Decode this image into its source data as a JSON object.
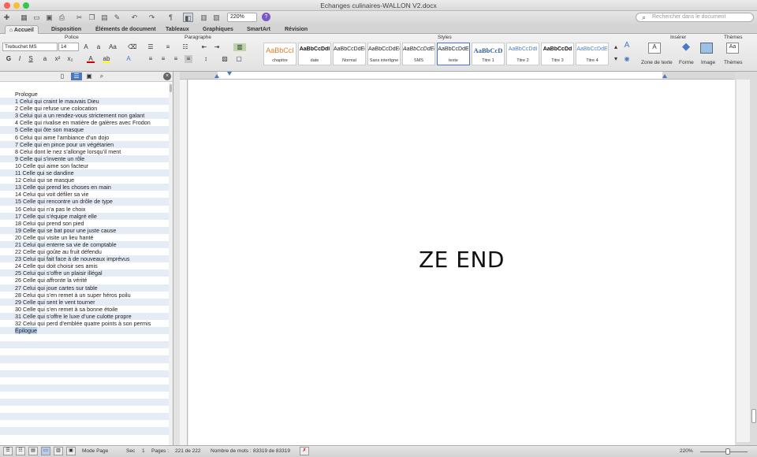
{
  "window": {
    "title": "Echanges culinaires-WALLON V2.docx"
  },
  "toolbar": {
    "zoom": "220%",
    "search_placeholder": "Rechercher dans le document"
  },
  "tabs": [
    "Accueil",
    "Disposition",
    "Éléments de document",
    "Tableaux",
    "Graphiques",
    "SmartArt",
    "Révision"
  ],
  "ribbon": {
    "groups": {
      "police": "Police",
      "paragraphe": "Paragraphe",
      "styles": "Styles",
      "inserer": "Insérer",
      "themes": "Thèmes"
    },
    "font_name": "Trebuchet MS",
    "font_size": "14",
    "styles": [
      {
        "sample": "AaBbCcI",
        "name": "chapitre",
        "color": "#e07a2a"
      },
      {
        "sample": "AaBbCcDdI",
        "name": "date",
        "color": "#111111"
      },
      {
        "sample": "AaBbCcDdEe",
        "name": "Normal",
        "color": "#222222"
      },
      {
        "sample": "AaBbCcDdEe",
        "name": "Sans interligne",
        "color": "#222222"
      },
      {
        "sample": "AaBbCcDdEe",
        "name": "SMS",
        "color": "#222222"
      },
      {
        "sample": "AaBbCcDdE",
        "name": "texte",
        "color": "#222222"
      },
      {
        "sample": "AaBbCcD",
        "name": "Titre 1",
        "color": "#2f5d9a"
      },
      {
        "sample": "AaBbCcDdI",
        "name": "Titre 2",
        "color": "#4f81bd"
      },
      {
        "sample": "AaBbCcDd",
        "name": "Titre 3",
        "color": "#111111"
      },
      {
        "sample": "AaBbCcDdE",
        "name": "Titre 4",
        "color": "#4f81bd"
      }
    ],
    "insert": {
      "textbox": "Zone de texte",
      "shape": "Forme",
      "image": "Image",
      "themes": "Thèmes"
    },
    "style_letters": {
      "bold": "G",
      "italic": "I",
      "underline": "S"
    }
  },
  "toc": [
    "Prologue",
    "1 Celui qui craint le mauvais Dieu",
    "2 Celle qui refuse une colocation",
    "3 Celui qui a un rendez-vous strictement non galant",
    "4 Celle qui rivalise en matière de galères avec Frodon",
    "5 Celle qui ôte son masque",
    "6 Celui qui aime l’ambiance d’un dojo",
    "7 Celle qui en pince pour un végétarien",
    "8 Celui dont le nez s’allonge lorsqu’il ment",
    "9 Celle qui s’invente un rôle",
    "10 Celle qui aime son facteur",
    "11 Celle qui se dandine",
    "12 Celui qui se masque",
    "13 Celle qui prend les choses en main",
    "14 Celui qui voit défiler sa vie",
    "15 Celle qui rencontre un drôle de type",
    "16 Celui qui n’a pas le choix",
    "17 Celle qui s’équipe malgré elle",
    "18 Celui qui prend son pied",
    "19 Celle qui se bat pour une juste cause",
    "20 Celle qui visite un lieu hanté",
    "21 Celui qui enterre sa vie de comptable",
    "22 Celle qui goûte au fruit défendu",
    "23 Celui qui fait face à de nouveaux imprévus",
    "24 Celle qui doit choisir ses amis",
    "25 Celui qui s’offre un plaisir illégal",
    "26 Celle qui affronte la vérité",
    "27 Celui qui joue cartes sur table",
    "28 Celui qui s’en remet à un super héros poilu",
    "29 Celle qui sent le vent tourner",
    "30 Celle qui s’en remet à sa bonne étoile",
    "31 Celle qui s’offre le luxe d’une culotte propre",
    "32 Celui qui perd d’emblée quatre points à son permis",
    "Épilogue"
  ],
  "document": {
    "text": "ZE END"
  },
  "status": {
    "view": "Mode Page",
    "section_label": "Sec",
    "section": "1",
    "pages_label": "Pages :",
    "pages": "221 de 222",
    "words_label": "Nombre de mots :",
    "words": "83319 de 83319",
    "zoom": "220%"
  },
  "colors": {
    "accent": "#4a78c2",
    "selection": "#b5cdea"
  }
}
